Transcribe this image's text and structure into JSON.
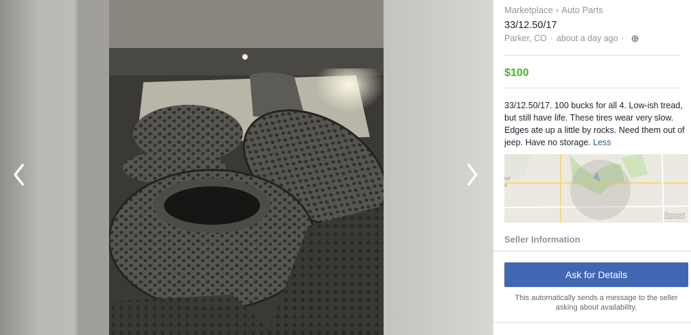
{
  "viewer": {
    "prev_icon": "chevron-left-icon",
    "next_icon": "chevron-right-icon"
  },
  "listing": {
    "breadcrumb": [
      "Marketplace",
      "Auto Parts"
    ],
    "breadcrumb_separator": "›",
    "title": "33/12.50/17",
    "location": "Parker, CO",
    "meta_dot": "·",
    "posted": "about a day ago",
    "visibility_icon": "globe-icon",
    "price": "$100",
    "description": "33/12.50/17.  100 bucks for all 4. Low-ish tread, but still have life. These tires wear very slow. Edges ate up a little by rocks. Need them out of jeep. Have no storage.",
    "less_link": "Less",
    "map_report": "Report",
    "map_partial_labels": [
      "ne",
      "e"
    ],
    "seller_heading": "Seller Information",
    "ask_button": "Ask for Details",
    "helper_text": "This automatically sends a message to the seller asking about availability."
  },
  "colors": {
    "price": "#42b72a",
    "button": "#4267b2",
    "link": "#365899",
    "muted": "#90949c"
  }
}
